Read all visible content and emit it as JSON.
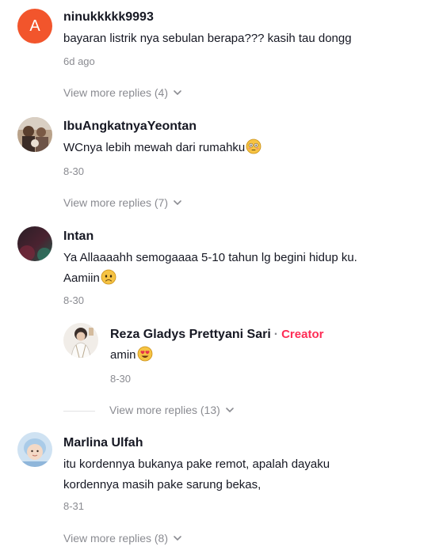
{
  "comments": [
    {
      "avatar_letter": "A",
      "username": "ninukkkkk9993",
      "text": "bayaran listrik nya sebulan berapa??? kasih tau dongg",
      "date": "6d ago",
      "replies_label": "View more replies (4)"
    },
    {
      "username": "IbuAngkatnyaYeontan",
      "text": "WCnya lebih mewah dari rumahku",
      "date": "8-30",
      "replies_label": "View more replies (7)"
    },
    {
      "username": "Intan",
      "text_line1": "Ya Allaaaahh semogaaaa 5-10 tahun lg begini hidup ku.",
      "text_line2": "Aamiin",
      "date": "8-30"
    },
    {
      "username": "Marlina Ulfah",
      "text_line1": "itu kordennya bukanya pake remot, apalah dayaku",
      "text_line2": "kordennya masih pake sarung bekas,",
      "date": "8-31",
      "replies_label": "View more replies (8)"
    }
  ],
  "reply": {
    "username": "Reza Gladys Prettyani Sari",
    "separator": "·",
    "badge": "Creator",
    "text": "amin",
    "date": "8-30",
    "replies_label": "View more replies (13)"
  },
  "colors": {
    "creator": "#fe2c55",
    "meta": "#8a8b91",
    "avatar_a": "#f2552c"
  },
  "icons": [
    "chevron-down-icon",
    "flushed-emoji-icon",
    "sad-emoji-icon",
    "heart-eyes-emoji-icon"
  ]
}
